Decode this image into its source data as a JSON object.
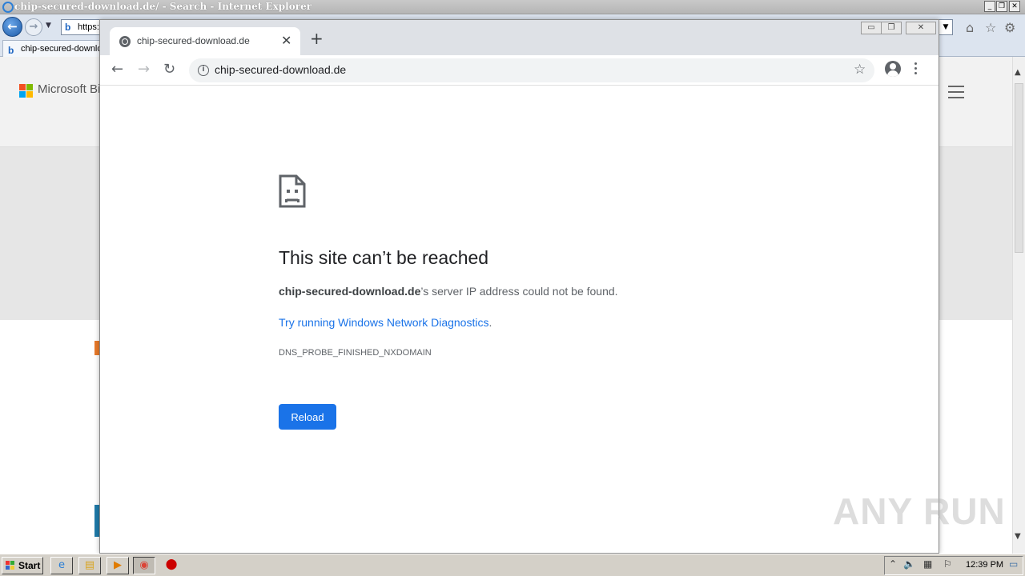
{
  "ie": {
    "window_title": "chip-secured-download.de/ - Search - Internet Explorer",
    "address_partial": "https:",
    "tab_label": "chip-secured-downlo",
    "bing_brand": "Microsoft Bi"
  },
  "chrome": {
    "tab_title": "chip-secured-download.de",
    "new_tab_symbol": "+",
    "url": "chip-secured-download.de"
  },
  "error_page": {
    "title": "This site can’t be reached",
    "host": "chip-secured-download.de",
    "message_suffix": "’s server IP address could not be found.",
    "diagnostics_link": "Try running Windows Network Diagnostics",
    "diagnostics_period": ".",
    "error_code": "DNS_PROBE_FINISHED_NXDOMAIN",
    "reload_label": "Reload"
  },
  "taskbar": {
    "start_label": "Start",
    "clock": "12:39 PM"
  },
  "watermark": "ANY RUN",
  "colors": {
    "chrome_blue": "#1a73e8",
    "tab_strip": "#dee1e6",
    "taskbar": "#d4d0c8"
  }
}
